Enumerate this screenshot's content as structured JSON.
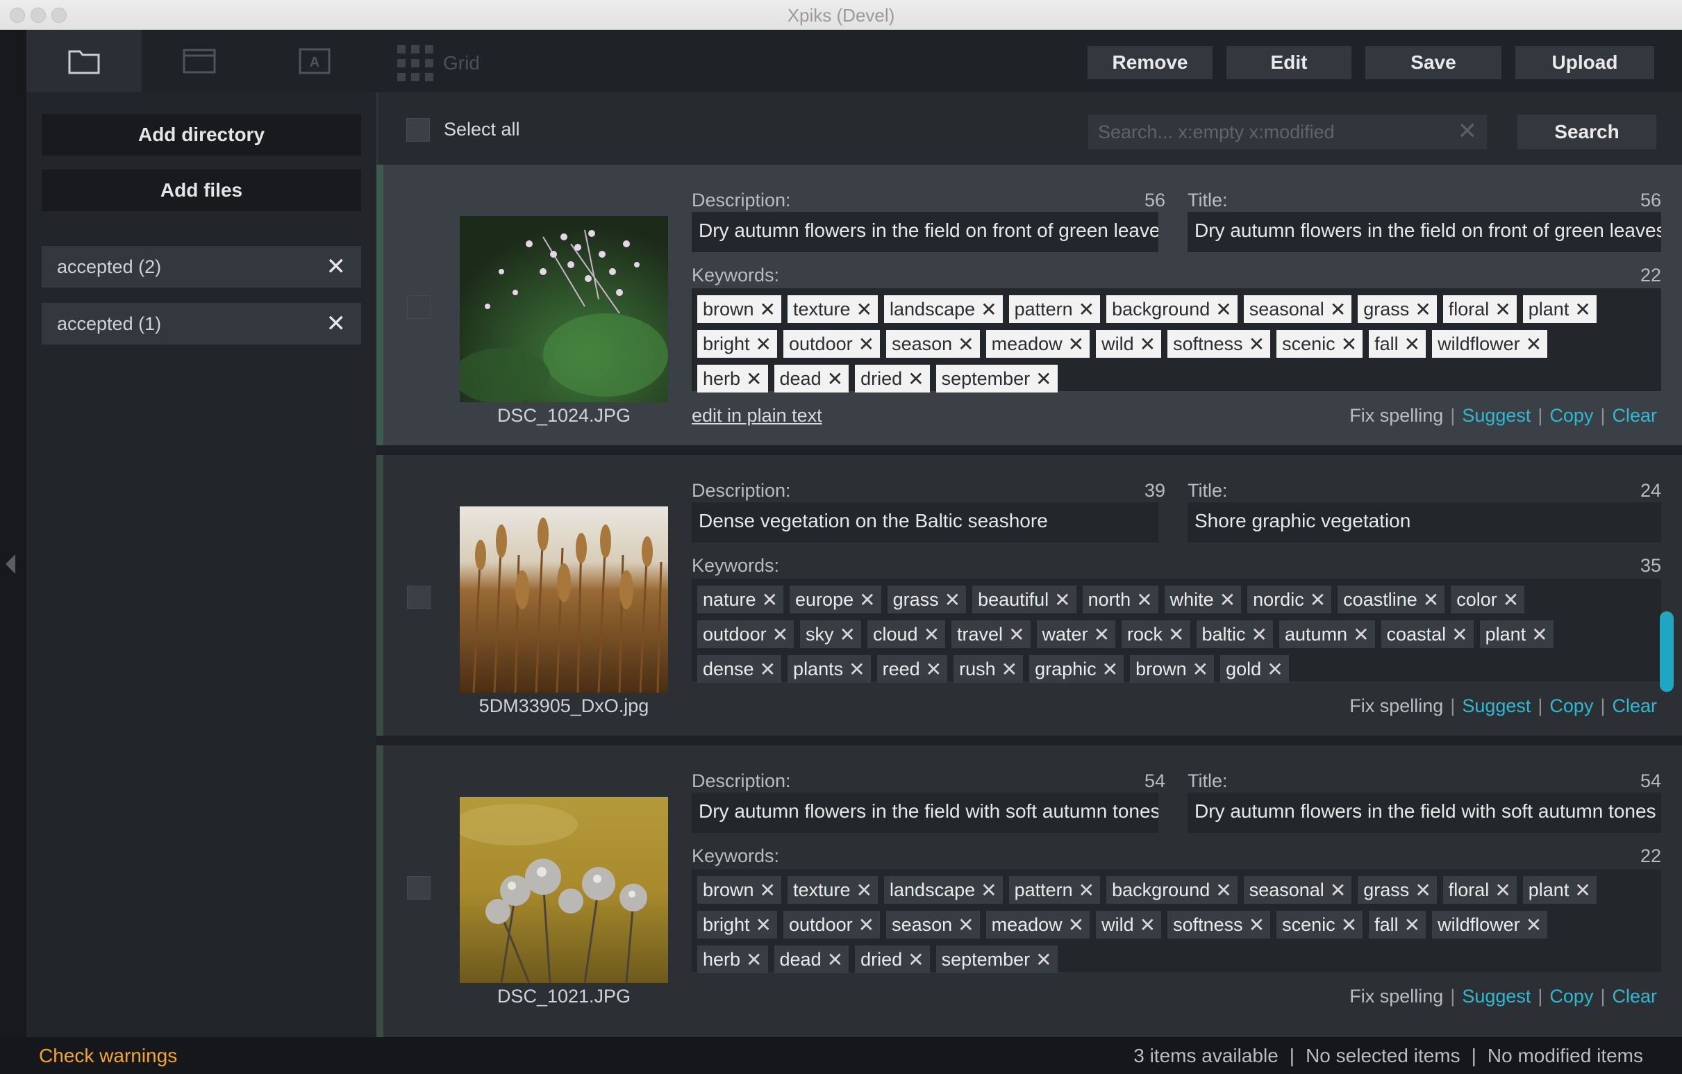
{
  "window": {
    "title": "Xpiks (Devel)"
  },
  "sidebar": {
    "add_directory": "Add directory",
    "add_files": "Add files",
    "items": [
      {
        "label": "accepted (2)"
      },
      {
        "label": "accepted (1)"
      }
    ]
  },
  "toolbar": {
    "grid_label": "Grid",
    "remove": "Remove",
    "edit": "Edit",
    "save": "Save",
    "upload": "Upload"
  },
  "filter": {
    "select_all": "Select all",
    "search_placeholder": "Search...  x:empty  x:modified",
    "search_button": "Search"
  },
  "labels": {
    "description": "Description:",
    "title": "Title:",
    "keywords": "Keywords:",
    "edit_plain": "edit in plain text",
    "fix_spelling": "Fix spelling",
    "suggest": "Suggest",
    "copy": "Copy",
    "clear": "Clear",
    "sep": "|"
  },
  "items": [
    {
      "filename": "DSC_1024.JPG",
      "description": "Dry autumn flowers in the field on front of green leaves",
      "description_count": "56",
      "title": "Dry autumn flowers in the field on front of green leaves",
      "title_count": "56",
      "keywords_count": "22",
      "keyword_rows": [
        [
          "brown",
          "texture",
          "landscape",
          "pattern",
          "background",
          "seasonal",
          "grass",
          "floral",
          "plant"
        ],
        [
          "bright",
          "outdoor",
          "season",
          "meadow",
          "wild",
          "softness",
          "scenic",
          "fall",
          "wildflower"
        ],
        [
          "herb",
          "dead",
          "dried",
          "september"
        ]
      ]
    },
    {
      "filename": "5DM33905_DxO.jpg",
      "description": "Dense vegetation on the Baltic seashore",
      "description_count": "39",
      "title": "Shore graphic vegetation",
      "title_count": "24",
      "keywords_count": "35",
      "keyword_rows": [
        [
          "nature",
          "europe",
          "grass",
          "beautiful",
          "north",
          "white",
          "nordic",
          "coastline",
          "color"
        ],
        [
          "outdoor",
          "sky",
          "cloud",
          "travel",
          "water",
          "rock",
          "baltic",
          "autumn",
          "coastal",
          "plant"
        ],
        [
          "dense",
          "plants",
          "reed",
          "rush",
          "graphic",
          "brown",
          "gold"
        ]
      ]
    },
    {
      "filename": "DSC_1021.JPG",
      "description": "Dry autumn flowers in the field with soft autumn tones",
      "description_count": "54",
      "title": "Dry autumn flowers in the field with soft autumn tones",
      "title_count": "54",
      "keywords_count": "22",
      "keyword_rows": [
        [
          "brown",
          "texture",
          "landscape",
          "pattern",
          "background",
          "seasonal",
          "grass",
          "floral",
          "plant"
        ],
        [
          "bright",
          "outdoor",
          "season",
          "meadow",
          "wild",
          "softness",
          "scenic",
          "fall",
          "wildflower"
        ],
        [
          "herb",
          "dead",
          "dried",
          "september"
        ]
      ]
    }
  ],
  "status": {
    "warnings": "Check warnings",
    "available": "3 items available",
    "selected": "No selected items",
    "modified": "No modified items"
  },
  "colors": {
    "accent_link": "#2bbbd3",
    "warning": "#f5a623",
    "scrollbar": "#1fa6c2"
  }
}
